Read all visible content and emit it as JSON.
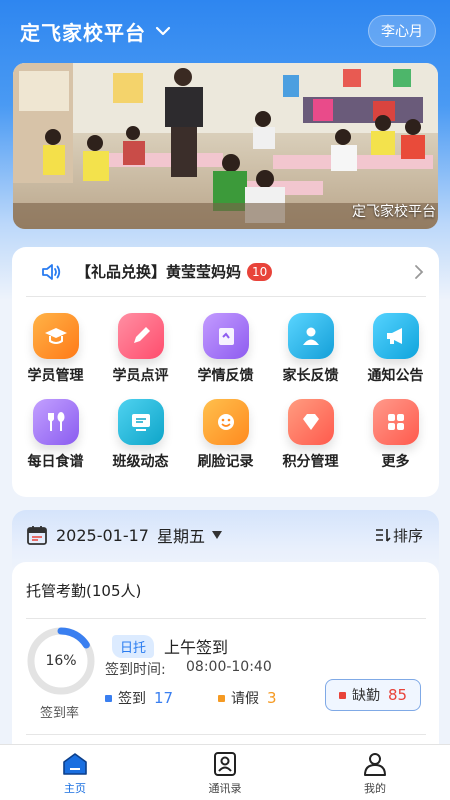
{
  "header": {
    "title": "定飞家校平台",
    "user_name": "李心月"
  },
  "banner": {
    "caption": "定飞家校平台"
  },
  "notice": {
    "text": "【礼品兑换】黄莹莹妈妈",
    "count": "10"
  },
  "menu": {
    "items": [
      {
        "label": "学员管理",
        "icon": "graduation-cap-icon",
        "color": "#ff8a1f"
      },
      {
        "label": "学员点评",
        "icon": "pencil-icon",
        "color": "#ff5d7a"
      },
      {
        "label": "学情反馈",
        "icon": "report-icon",
        "color": "#a06bf0"
      },
      {
        "label": "家长反馈",
        "icon": "parent-icon",
        "color": "#1fb6e8"
      },
      {
        "label": "通知公告",
        "icon": "megaphone-icon",
        "color": "#19b4e6"
      },
      {
        "label": "每日食谱",
        "icon": "cutlery-icon",
        "color": "#9b6bf2"
      },
      {
        "label": "班级动态",
        "icon": "class-board-icon",
        "color": "#14b3d8"
      },
      {
        "label": "刷脸记录",
        "icon": "face-icon",
        "color": "#ffa126"
      },
      {
        "label": "积分管理",
        "icon": "diamond-icon",
        "color": "#ff6e5c"
      },
      {
        "label": "更多",
        "icon": "grid-icon",
        "color": "#ff6b5e"
      }
    ]
  },
  "date_bar": {
    "date": "2025-01-17",
    "weekday": "星期五",
    "sort_label": "排序"
  },
  "attendance": {
    "title": "托管考勤(105人)",
    "rate": "16%",
    "rate_value": 0.16,
    "rate_label": "签到率",
    "tag": "日托",
    "session": "上午签到",
    "time_label": "签到时间:",
    "time_range": "08:00-10:40",
    "signed_label": "签到",
    "signed_count": "17",
    "leave_label": "请假",
    "leave_count": "3",
    "absent_label": "缺勤",
    "absent_count": "85",
    "colors": {
      "signed": "#3a7ff0",
      "leave": "#f59a23",
      "absent": "#e8433a"
    }
  },
  "bottom_nav": {
    "home": "主页",
    "contacts": "通讯录",
    "mine": "我的"
  }
}
